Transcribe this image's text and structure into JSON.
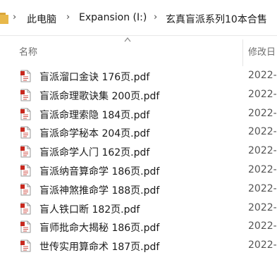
{
  "breadcrumb": {
    "items": [
      "此电脑",
      "Expansion (I:)",
      "玄真盲派系列10本合售"
    ],
    "separator": "›"
  },
  "columns": {
    "name": "名称",
    "date_modified": "修改日"
  },
  "files": [
    {
      "name": "盲派溜口金诀 176页.pdf",
      "date": "2022-"
    },
    {
      "name": "盲派命理歌诀集 200页.pdf",
      "date": "2022-"
    },
    {
      "name": "盲派命理索隐 184页.pdf",
      "date": "2022-"
    },
    {
      "name": "盲派命学秘本 204页.pdf",
      "date": "2022-"
    },
    {
      "name": "盲派命学人门 162页.pdf",
      "date": "2022-"
    },
    {
      "name": "盲派纳音算命学 186页.pdf",
      "date": "2022-"
    },
    {
      "name": "盲派神煞推命学 188页.pdf",
      "date": "2022-"
    },
    {
      "name": "盲人铁口断 182页.pdf",
      "date": "2022-"
    },
    {
      "name": "盲师批命大揭秘 186页.pdf",
      "date": "2022-"
    },
    {
      "name": "世传实用算命术 187页.pdf",
      "date": "2022-"
    }
  ],
  "icons": {
    "folder": "folder-icon",
    "file": "pdf-file-icon",
    "sort": "sort-up-icon"
  },
  "colors": {
    "folder": "#e8b84a",
    "pdf_red": "#c8281e"
  }
}
